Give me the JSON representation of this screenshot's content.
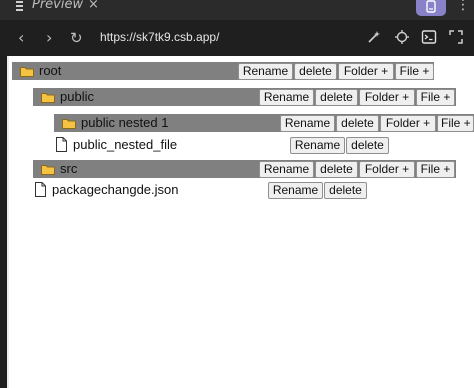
{
  "browser": {
    "tab_title": "Preview",
    "tab_close_glyph": "×",
    "menu_glyph": "⋮",
    "url": "https://sk7tk9.csb.app/",
    "back_glyph": "‹",
    "forward_glyph": "›",
    "reload_glyph": "↻",
    "icons": [
      "tab-list-icon",
      "profile-icon",
      "back-icon",
      "forward-icon",
      "reload-icon",
      "wand-icon",
      "crosshair-icon",
      "console-icon",
      "fullscreen-icon"
    ]
  },
  "tree": {
    "colors": {
      "folder_row_bg": "#808080",
      "folder_icon_fill": "#f5c242",
      "folder_icon_stroke": "#8a6a1f"
    },
    "root": {
      "name": "root",
      "rename_label": "Rename",
      "delete_label": "delete",
      "add_folder_label": "Folder +",
      "add_file_label": "File +"
    },
    "public": {
      "name": "public",
      "rename_label": "Rename",
      "delete_label": "delete",
      "add_folder_label": "Folder +",
      "add_file_label": "File +"
    },
    "public_nested": {
      "name": "public nested 1",
      "rename_label": "Rename",
      "delete_label": "delete",
      "add_folder_label": "Folder +",
      "add_file_label": "File +"
    },
    "public_nested_file": {
      "name": "public_nested_file",
      "rename_label": "Rename",
      "delete_label": "delete"
    },
    "src": {
      "name": "src",
      "rename_label": "Rename",
      "delete_label": "delete",
      "add_folder_label": "Folder +",
      "add_file_label": "File +"
    },
    "package_file": {
      "name": "packagechangde.json",
      "rename_label": "Rename",
      "delete_label": "delete"
    }
  }
}
